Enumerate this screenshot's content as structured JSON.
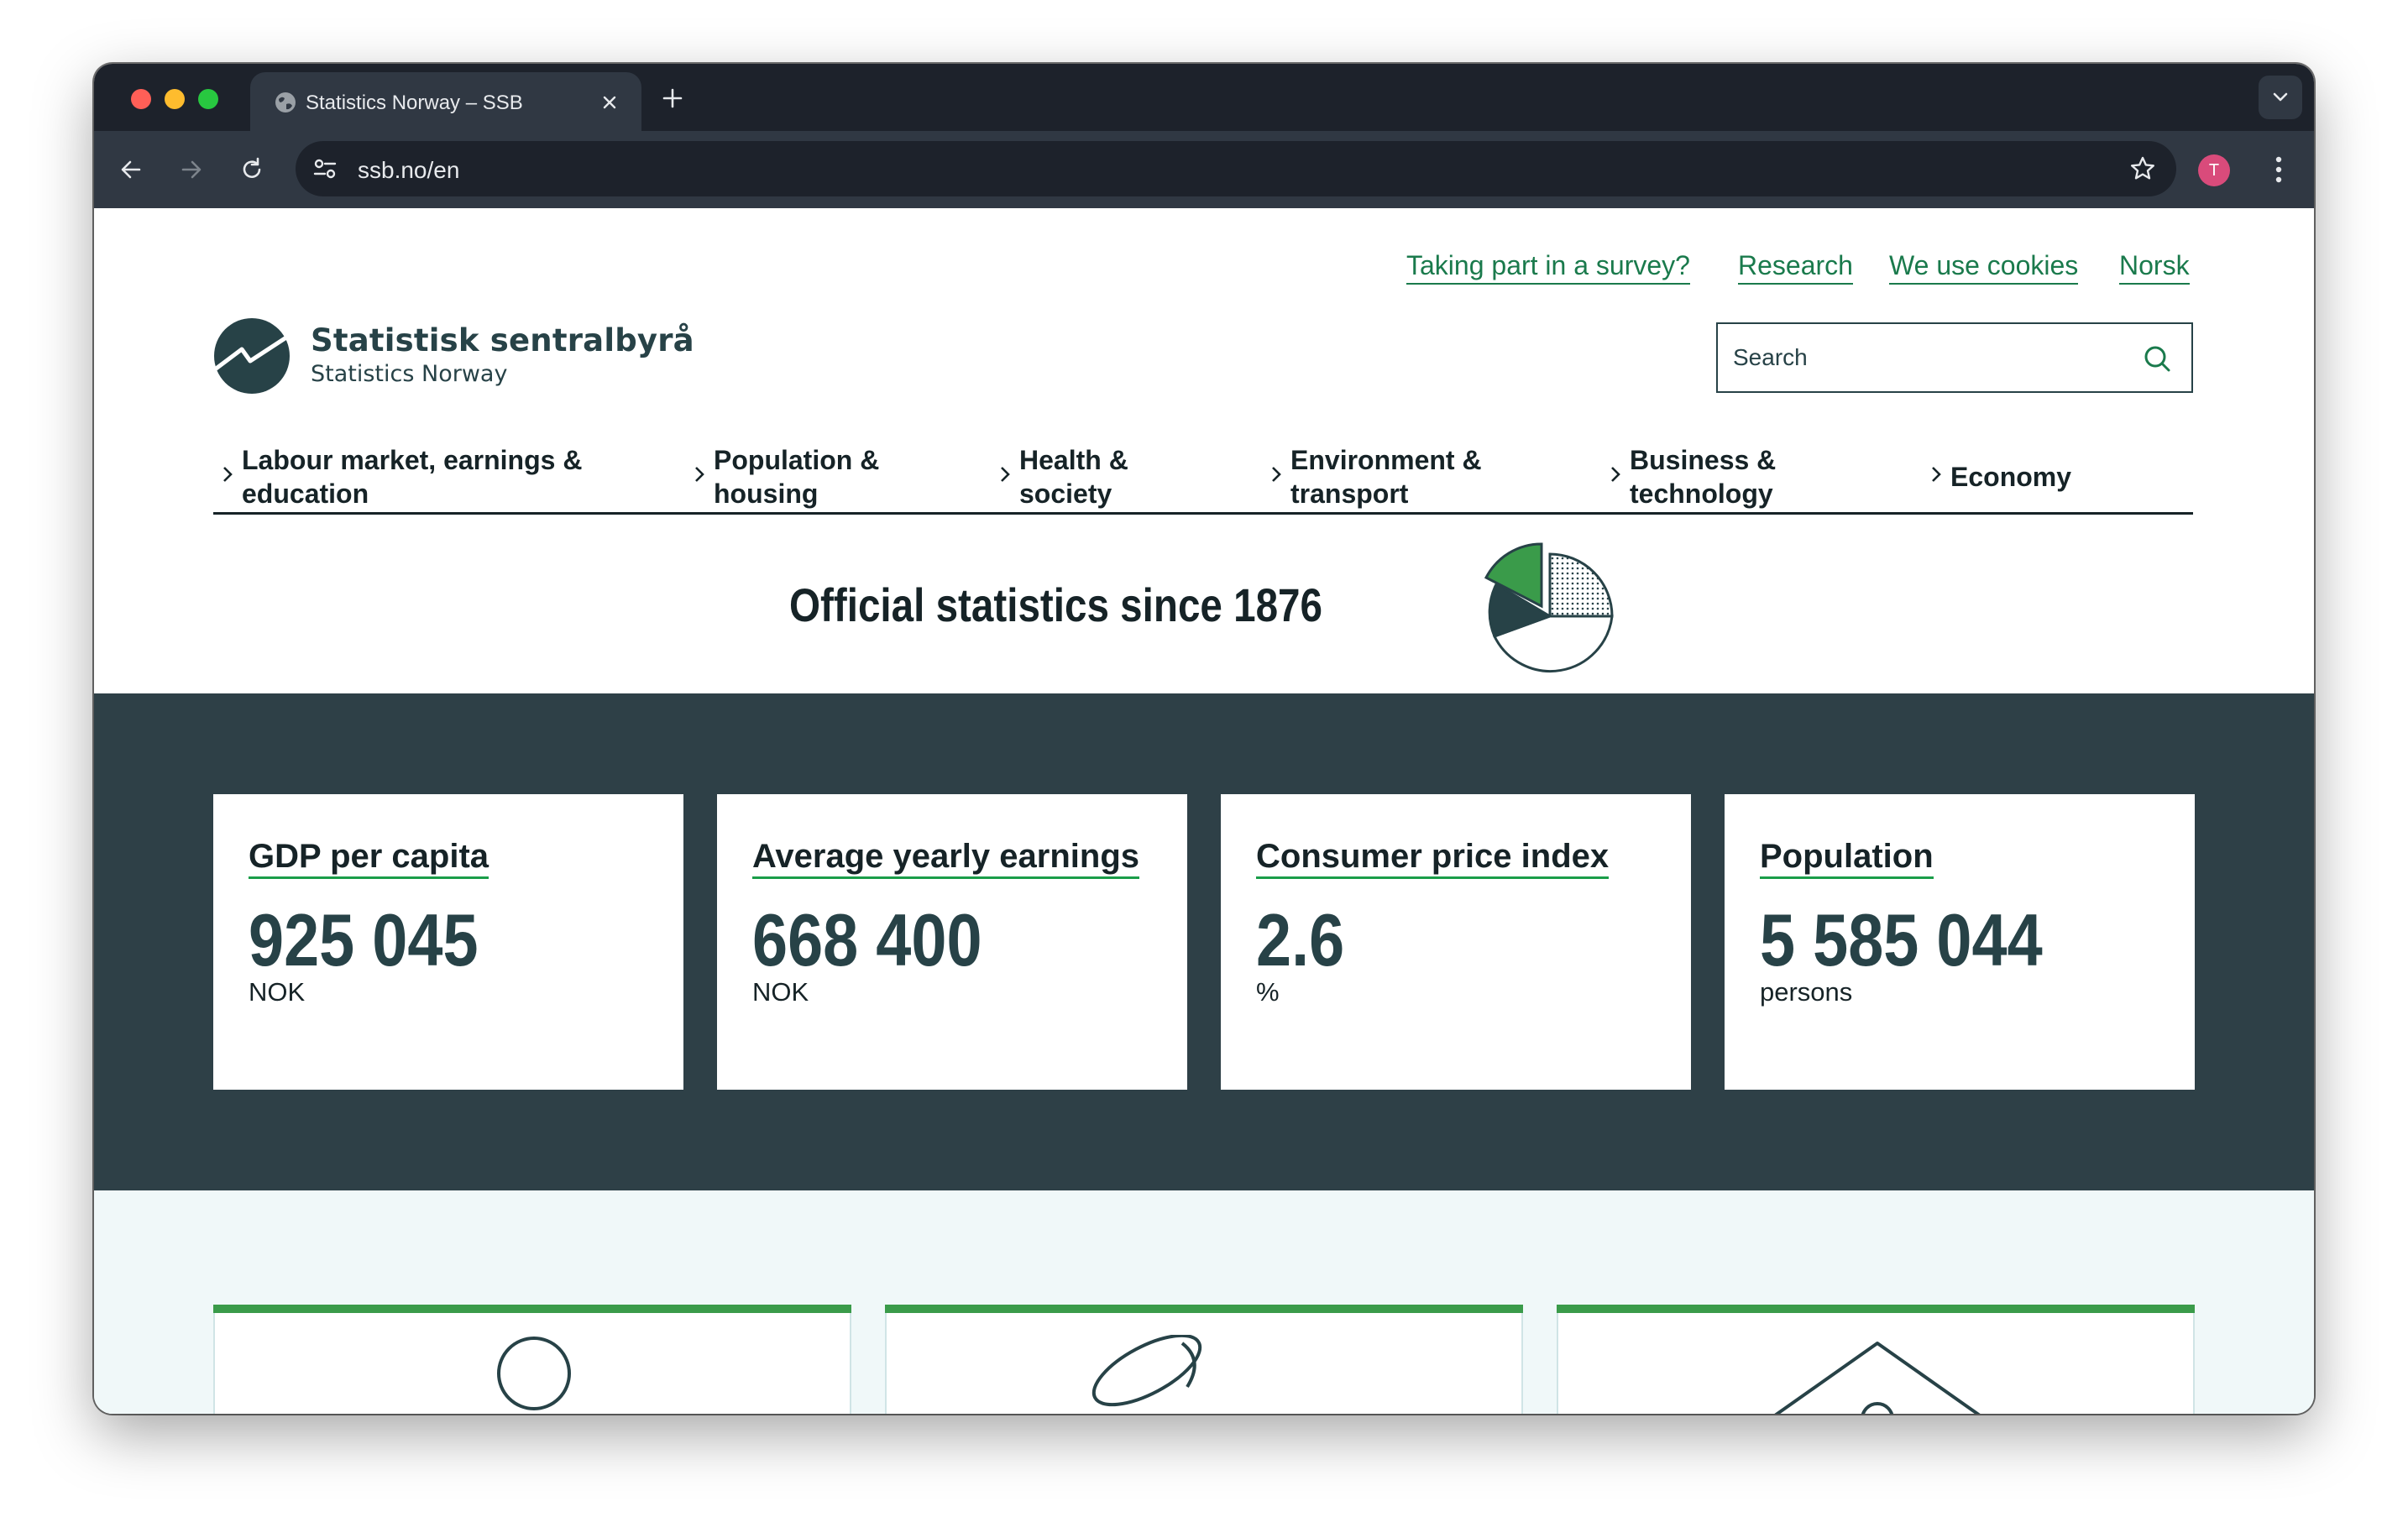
{
  "browser": {
    "tab_title": "Statistics Norway – SSB",
    "url": "ssb.no/en",
    "profile_initial": "T"
  },
  "page": {
    "top_links": [
      "Taking part in a survey?",
      "Research",
      "We use cookies",
      "Norsk"
    ],
    "brand": {
      "title": "Statistisk sentralbyrå",
      "subtitle": "Statistics Norway"
    },
    "search": {
      "placeholder": "Search"
    },
    "nav": [
      "Labour market, earnings &\neducation",
      "Population &\nhousing",
      "Health &\nsociety",
      "Environment &\ntransport",
      "Business &\ntechnology",
      "Economy"
    ],
    "hero_title": "Official statistics since 1876",
    "key_figures": [
      {
        "title": "GDP per capita",
        "value": "925 045",
        "unit": "NOK"
      },
      {
        "title": "Average yearly earnings",
        "value": "668 400",
        "unit": "NOK"
      },
      {
        "title": "Consumer price index",
        "value": "2.6",
        "unit": "%"
      },
      {
        "title": "Population",
        "value": "5 585 044",
        "unit": "persons"
      }
    ]
  },
  "colors": {
    "chrome_dark": "#1d222b",
    "chrome_toolbar": "#303843",
    "ssb_green": "#1a7a4c",
    "ssb_dark": "#2e4047",
    "accent_green": "#3a9b4a",
    "lower_bg": "#f0f8f9"
  },
  "icons": {
    "tab_favicon": "globe-icon",
    "search": "search-icon",
    "nav_chevron": "chevron-right-icon",
    "hero": "pie-chart-icon"
  }
}
